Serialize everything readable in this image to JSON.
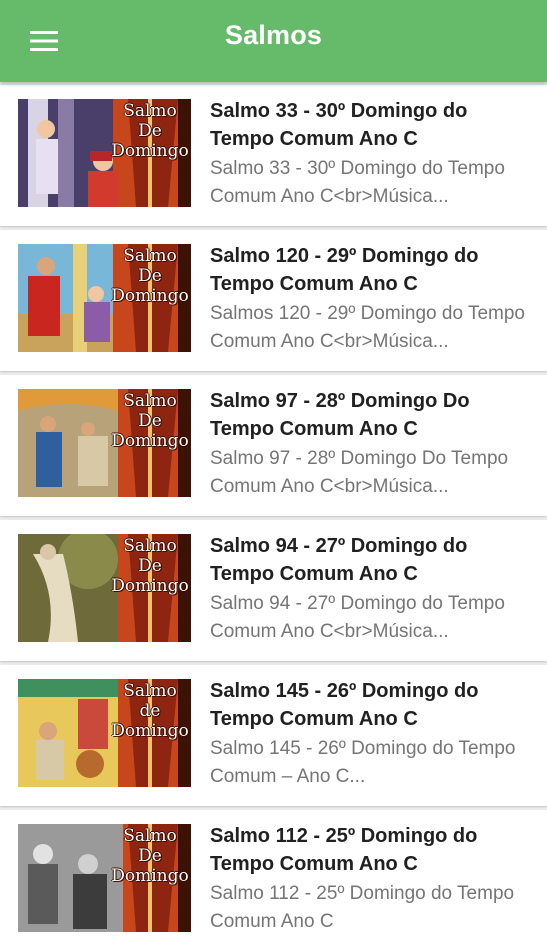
{
  "appbar": {
    "title": "Salmos",
    "menu_icon": "hamburger-menu-icon"
  },
  "thumbnail_caption": "Salmo\nDe\nDomingo",
  "items": [
    {
      "title": "Salmo 33 - 30º Domingo do Tempo Comum Ano C",
      "subtitle": "Salmo 33 - 30º Domingo do Tempo Comum Ano C<br>Música...",
      "caption": "Salmo\nDe\nDomingo"
    },
    {
      "title": "Salmo 120 - 29º Domingo do Tempo Comum Ano C",
      "subtitle": "Salmos 120 - 29º Domingo do Tempo Comum Ano C<br>Música...",
      "caption": "Salmo\nDe\nDomingo"
    },
    {
      "title": "Salmo 97 - 28º Domingo Do Tempo Comum Ano C",
      "subtitle": "Salmo 97 - 28º Domingo Do Tempo Comum Ano C<br>Música...",
      "caption": "Salmo\nDe\nDomingo"
    },
    {
      "title": "Salmo 94 - 27º Domingo do Tempo Comum Ano C",
      "subtitle": "Salmo 94 - 27º Domingo do Tempo Comum Ano C<br>Música...",
      "caption": "Salmo\nDe\nDomingo"
    },
    {
      "title": "Salmo 145 - 26º Domingo do Tempo Comum Ano C",
      "subtitle": "Salmo 145 - 26º Domingo do Tempo Comum – Ano C...",
      "caption": "Salmo\nde\nDomingo"
    },
    {
      "title": "Salmo 112 - 25º Domingo do Tempo Comum Ano C",
      "subtitle": "Salmo 112 - 25º Domingo do Tempo Comum Ano C",
      "caption": "Salmo\nDe\nDomingo"
    }
  ],
  "colors": {
    "appbar": "#66bb6a",
    "background": "#eeeeee",
    "title_text": "#212121",
    "subtitle_text": "#757575"
  }
}
